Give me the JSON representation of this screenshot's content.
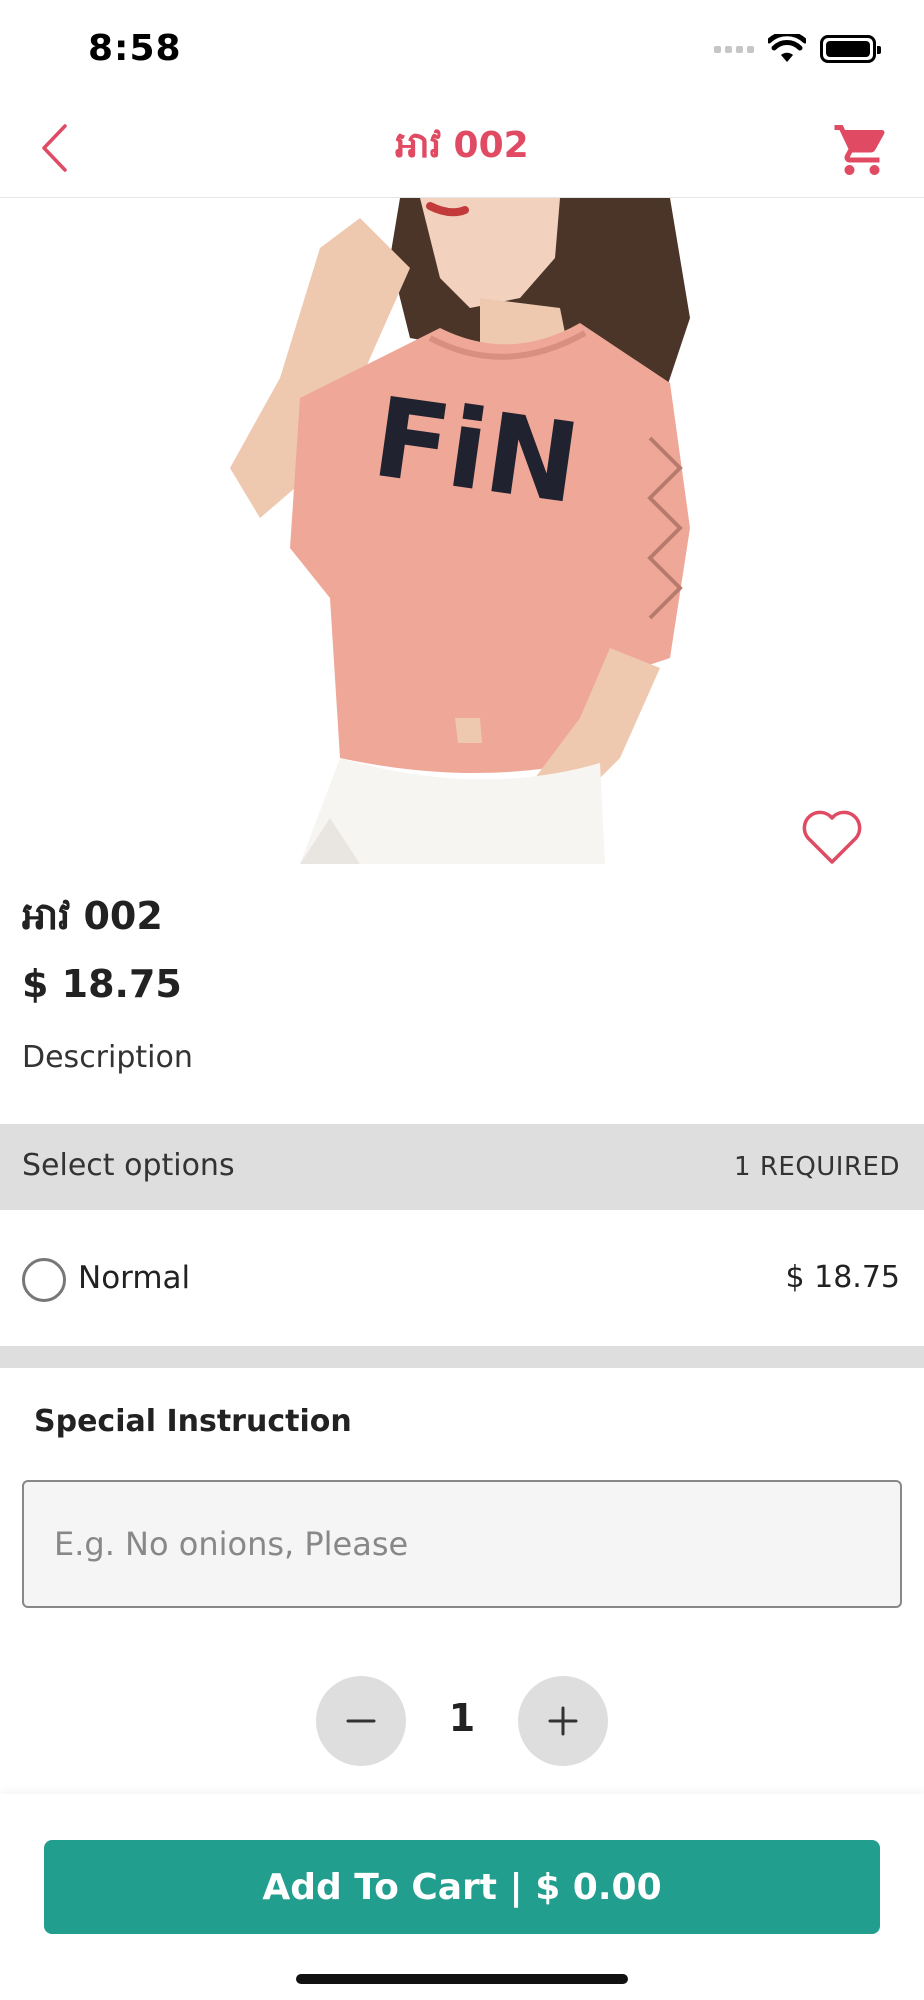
{
  "status_bar": {
    "time": "8:58"
  },
  "nav": {
    "title": "អាវ 002",
    "back_icon": "chevron-left-icon",
    "cart_icon": "cart-icon"
  },
  "product": {
    "name": "អាវ 002",
    "price": "$ 18.75",
    "description": "Description",
    "image_text": "FiN",
    "favorite_icon": "heart-outline-icon"
  },
  "options": {
    "title": "Select options",
    "required": "1 REQUIRED",
    "items": [
      {
        "label": "Normal",
        "price": "$ 18.75",
        "selected": false
      }
    ]
  },
  "special": {
    "title": "Special Instruction",
    "placeholder": "E.g. No onions, Please",
    "value": ""
  },
  "quantity": {
    "value": "1"
  },
  "cart_button": {
    "label": "Add To Cart | $ 0.00"
  },
  "colors": {
    "accent": "#e04a62",
    "primary": "#229e8e",
    "band": "#dedede"
  }
}
